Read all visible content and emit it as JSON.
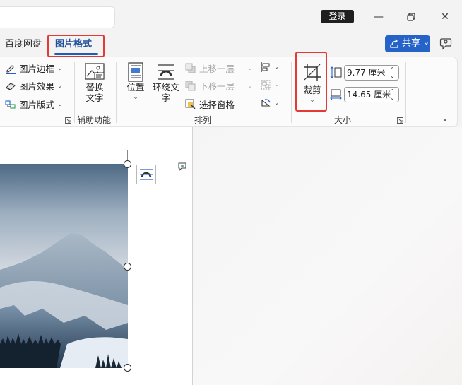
{
  "titlebar": {
    "login_label": "登录",
    "minimize_glyph": "—",
    "restore_glyph": "❐",
    "close_glyph": "✕"
  },
  "tabs": {
    "items": [
      {
        "label": "百度网盘"
      },
      {
        "label": "图片格式",
        "active": true
      }
    ]
  },
  "share": {
    "label": "共享",
    "chevron": "⌄"
  },
  "ribbon": {
    "picture_styles": {
      "border_label": "图片边框",
      "effects_label": "图片效果",
      "layout_label": "图片版式"
    },
    "accessibility": {
      "alt_text_label": "替换文字",
      "group_label": "辅助功能"
    },
    "arrange": {
      "position_label": "位置",
      "wrap_text_label": "环绕文字",
      "bring_forward_label": "上移一层",
      "send_backward_label": "下移一层",
      "selection_pane_label": "选择窗格",
      "group_label": "排列"
    },
    "size": {
      "crop_label": "裁剪",
      "height_value": "9.77 厘米",
      "width_value": "14.65 厘米",
      "group_label": "大小"
    }
  },
  "colors": {
    "accent": "#2563c9",
    "highlight_box": "#e53935",
    "tab_active": "#1f4e9c"
  }
}
